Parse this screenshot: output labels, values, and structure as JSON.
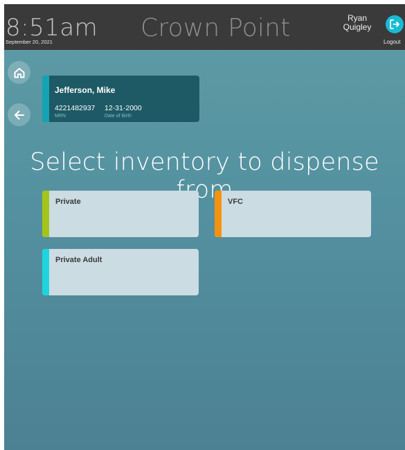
{
  "header": {
    "time": "8:51am",
    "date": "September 20, 2021",
    "app_title": "Crown Point",
    "user_first": "Ryan",
    "user_last": "Quigley",
    "logout_label": "Logout",
    "logout_icon": "logout-icon",
    "background_color": "#3a3a3a",
    "logout_color": "#19bbd2"
  },
  "nav": {
    "home_icon": "home-icon",
    "back_icon": "arrow-left-icon"
  },
  "patient": {
    "name": "Jefferson, Mike",
    "mrn": "4221482937",
    "mrn_label": "MRN",
    "dob": "12-31-2000",
    "dob_label": "Date of Birth",
    "card_color": "#1e5a65",
    "accent_color": "#14a3b5"
  },
  "main": {
    "heading": "Select inventory to dispense from",
    "inventories": [
      {
        "label": "Private",
        "color": "#a4c41a"
      },
      {
        "label": "VFC",
        "color": "#f5920f"
      },
      {
        "label": "Private Adult",
        "color": "#1ed4de"
      }
    ]
  }
}
